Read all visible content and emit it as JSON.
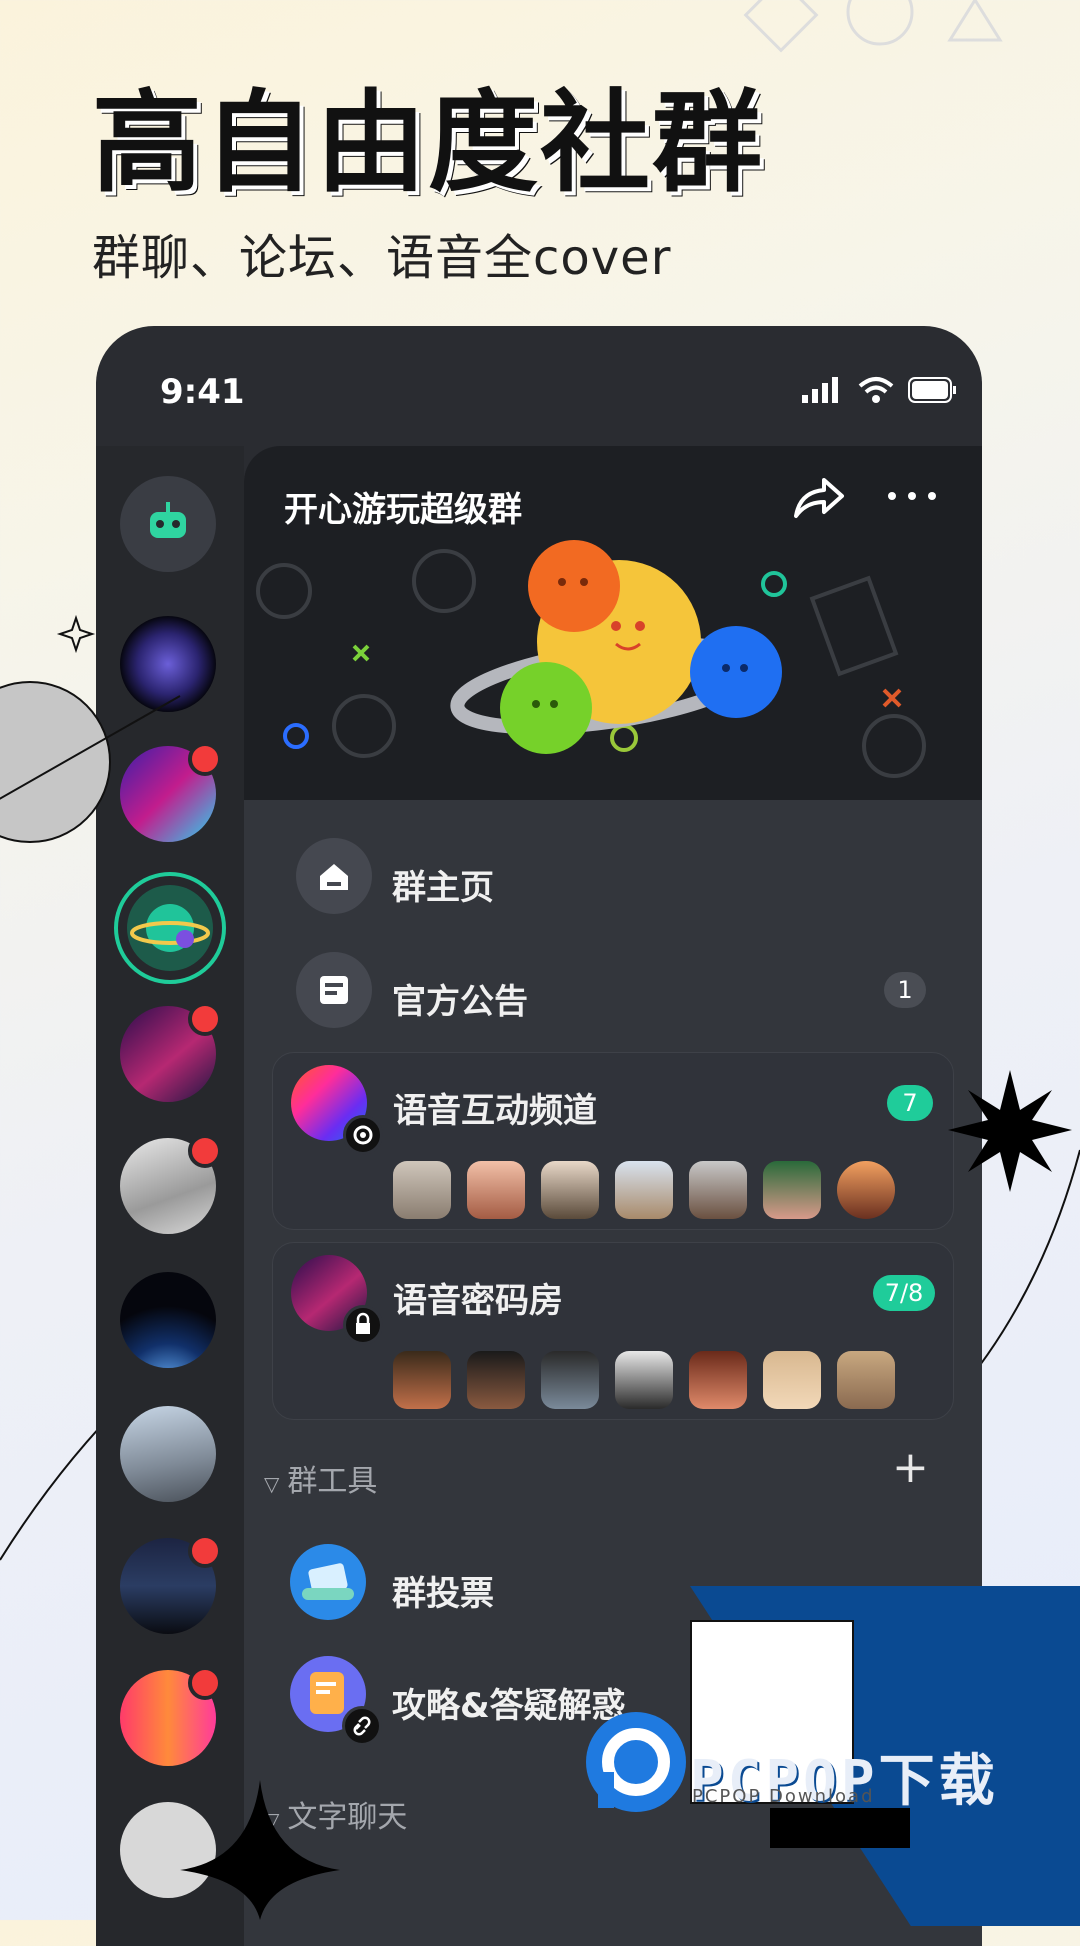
{
  "headline": "高自由度社群",
  "subline": "群聊、论坛、语音全cover",
  "status": {
    "time": "9:41"
  },
  "group": {
    "title": "开心游玩超级群"
  },
  "menu": {
    "home": "群主页",
    "notice": "官方公告",
    "notice_badge": "1"
  },
  "voice_channel": {
    "name": "语音互动频道",
    "badge": "7"
  },
  "voice_room": {
    "name": "语音密码房",
    "badge": "7/8"
  },
  "tools_section": {
    "label": "群工具",
    "add": "+"
  },
  "tools": [
    {
      "label": "群投票"
    },
    {
      "label": "攻略&答疑解惑"
    }
  ],
  "text_section": {
    "label": "文字聊天"
  },
  "watermark": {
    "brand": "PCPOP下载",
    "sub": "PCPOP Download"
  },
  "colors": {
    "accent": "#1fcc9a",
    "badge_red": "#f23b3b",
    "bg_dark": "#2a2c31"
  }
}
